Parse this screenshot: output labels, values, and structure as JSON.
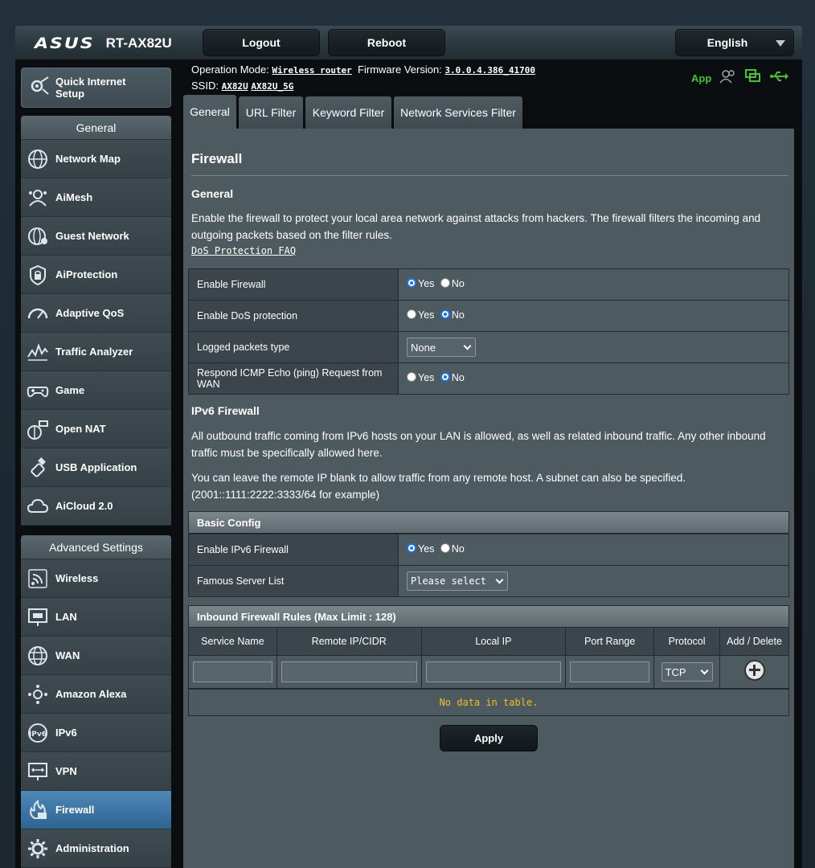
{
  "header": {
    "brand": "ASUS",
    "model": "RT-AX82U",
    "logout_label": "Logout",
    "reboot_label": "Reboot",
    "language": "English"
  },
  "status": {
    "operation_mode_label": "Operation Mode:",
    "operation_mode_value": "Wireless router",
    "firmware_label": "Firmware Version:",
    "firmware_value": "3.0.0.4.386_41700",
    "ssid_label": "SSID:",
    "ssid_1": "AX82U",
    "ssid_2": "AX82U_5G",
    "app_label": "App",
    "accent_green": "#43c42c"
  },
  "sidebar": {
    "quick_setup": "Quick Internet Setup",
    "general_title": "General",
    "general_items": [
      {
        "label": "Network Map",
        "icon": "globe-icon"
      },
      {
        "label": "AiMesh",
        "icon": "aimesh-icon"
      },
      {
        "label": "Guest Network",
        "icon": "guest-network-icon"
      },
      {
        "label": "AiProtection",
        "icon": "lock-icon"
      },
      {
        "label": "Adaptive QoS",
        "icon": "speedometer-icon"
      },
      {
        "label": "Traffic Analyzer",
        "icon": "traffic-chart-icon"
      },
      {
        "label": "Game",
        "icon": "gamepad-icon"
      },
      {
        "label": "Open NAT",
        "icon": "open-nat-icon"
      },
      {
        "label": "USB Application",
        "icon": "usb-icon"
      },
      {
        "label": "AiCloud 2.0",
        "icon": "cloud-icon"
      }
    ],
    "advanced_title": "Advanced Settings",
    "advanced_items": [
      {
        "label": "Wireless",
        "icon": "wifi-icon"
      },
      {
        "label": "LAN",
        "icon": "lan-icon"
      },
      {
        "label": "WAN",
        "icon": "wan-globe-icon"
      },
      {
        "label": "Amazon Alexa",
        "icon": "alexa-icon"
      },
      {
        "label": "IPv6",
        "icon": "ipv6-icon"
      },
      {
        "label": "VPN",
        "icon": "vpn-icon"
      },
      {
        "label": "Firewall",
        "icon": "firewall-icon",
        "active": true
      },
      {
        "label": "Administration",
        "icon": "admin-gear-icon"
      }
    ],
    "active_color": "#3d77a8"
  },
  "tabs": [
    {
      "label": "General",
      "active": true
    },
    {
      "label": "URL Filter"
    },
    {
      "label": "Keyword Filter"
    },
    {
      "label": "Network Services Filter"
    }
  ],
  "main": {
    "title": "Firewall",
    "general_heading": "General",
    "general_desc": "Enable the firewall to protect your local area network against attacks from hackers. The firewall filters the incoming and outgoing packets based on the filter rules.",
    "faq_link": "DoS Protection FAQ",
    "yes": "Yes",
    "no": "No",
    "rows": [
      {
        "label": "Enable Firewall",
        "value": "Yes"
      },
      {
        "label": "Enable DoS protection",
        "value": "No"
      },
      {
        "label": "Logged packets type",
        "select": "None"
      },
      {
        "label": "Respond ICMP Echo (ping) Request from WAN",
        "value": "No"
      }
    ],
    "ipv6_heading": "IPv6 Firewall",
    "ipv6_desc_1": "All outbound traffic coming from IPv6 hosts on your LAN is allowed, as well as related inbound traffic. Any other inbound traffic must be specifically allowed here.",
    "ipv6_desc_2": "You can leave the remote IP blank to allow traffic from any remote host. A subnet can also be specified. (2001::1111:2222:3333/64 for example)",
    "basic_config": "Basic Config",
    "ipv6_rows": [
      {
        "label": "Enable IPv6 Firewall",
        "value": "Yes"
      },
      {
        "label": "Famous Server List",
        "select": "Please select"
      }
    ],
    "rules_heading": "Inbound Firewall Rules (Max Limit : 128)",
    "rules_columns": [
      "Service Name",
      "Remote IP/CIDR",
      "Local IP",
      "Port Range",
      "Protocol",
      "Add / Delete"
    ],
    "protocol_value": "TCP",
    "no_data": "No data in table.",
    "apply_label": "Apply",
    "no_data_color": "#f5be21"
  }
}
